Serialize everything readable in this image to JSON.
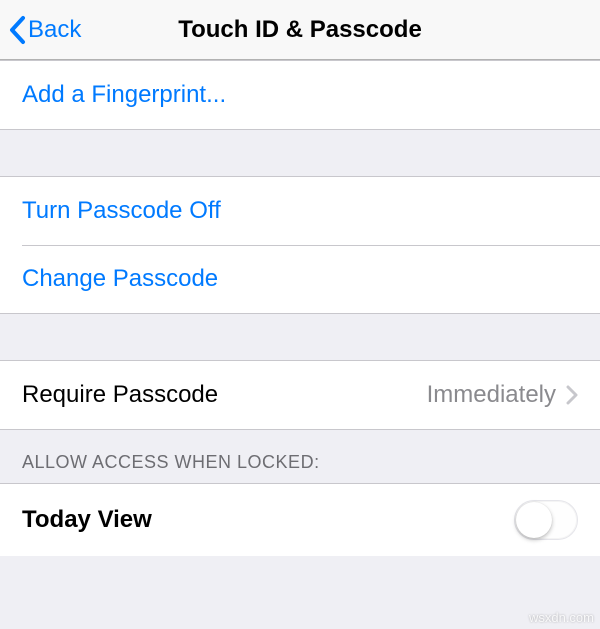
{
  "navbar": {
    "back_label": "Back",
    "title": "Touch ID & Passcode"
  },
  "sections": {
    "fingerprint": {
      "add_label": "Add a Fingerprint..."
    },
    "passcode": {
      "turn_off_label": "Turn Passcode Off",
      "change_label": "Change Passcode"
    },
    "require": {
      "label": "Require Passcode",
      "value": "Immediately"
    },
    "lock_access": {
      "header": "ALLOW ACCESS WHEN LOCKED:",
      "today_view_label": "Today View",
      "today_view_on": false
    }
  },
  "watermark": "wsxdn.com"
}
